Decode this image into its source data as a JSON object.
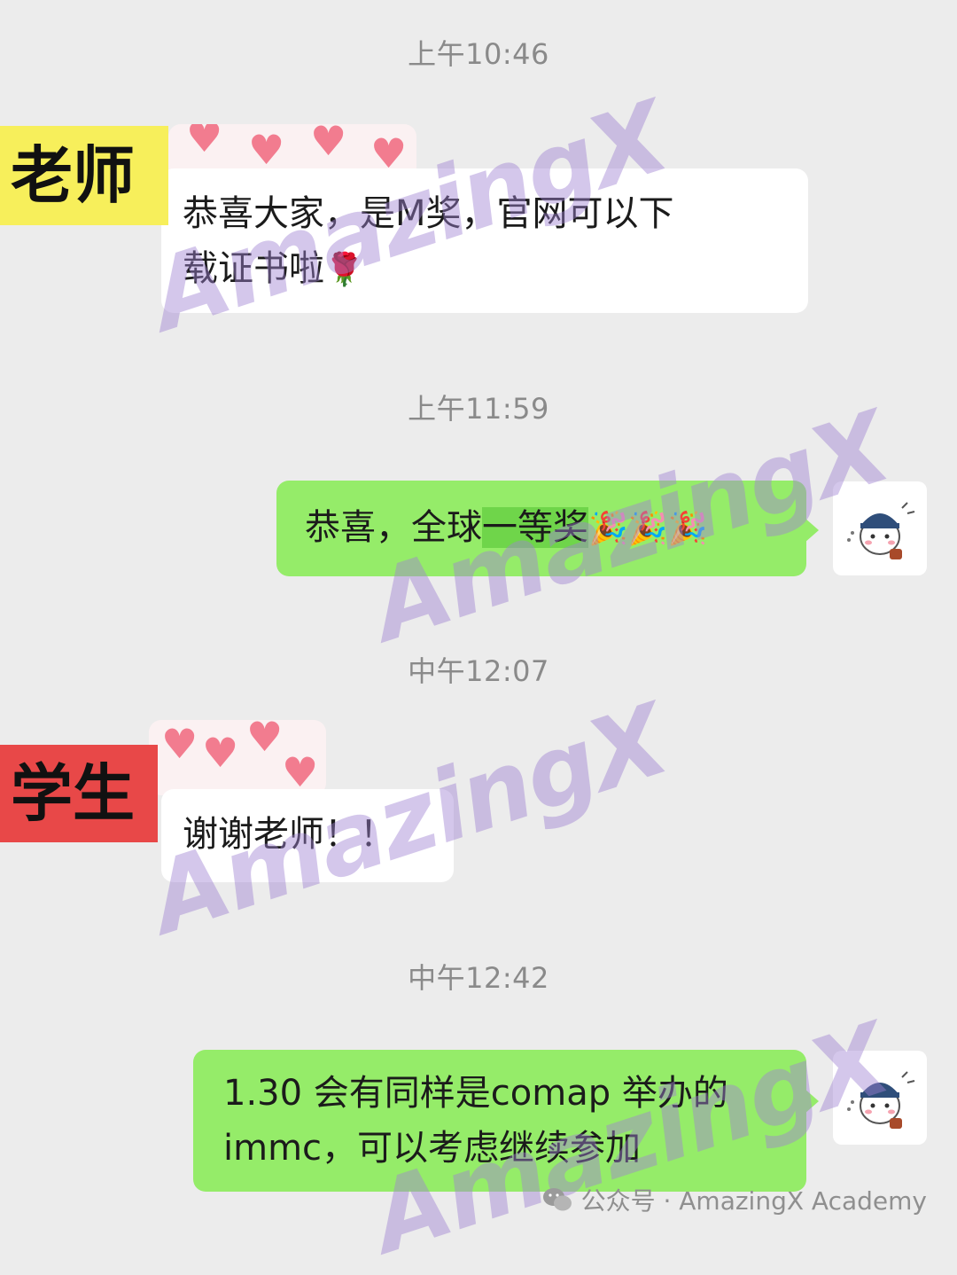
{
  "timestamps": [
    "上午10:46",
    "上午11:59",
    "中午12:07",
    "中午12:42"
  ],
  "tags": {
    "teacher": "老师",
    "student": "学生"
  },
  "messages": {
    "m1": {
      "line1": "恭喜大家，是M奖，官网可以下",
      "line2": "载证书啦",
      "emoji": "🌹"
    },
    "m2": {
      "prefix": "恭喜，全球",
      "highlight": "一等奖",
      "emoji": "🎉🎉🎉"
    },
    "m3": {
      "text": "谢谢老师！！"
    },
    "m4": {
      "line1": "1.30 会有同样是comap 举办的",
      "line2": "immc，可以考虑继续参加"
    }
  },
  "watermark": "AmazingX",
  "footer": {
    "icon": "wechat-icon",
    "text": "公众号 · AmazingX Academy"
  },
  "colors": {
    "green_bubble": "#95ec69",
    "teacher_tag": "#f7ef5b",
    "student_tag": "#e84848"
  }
}
